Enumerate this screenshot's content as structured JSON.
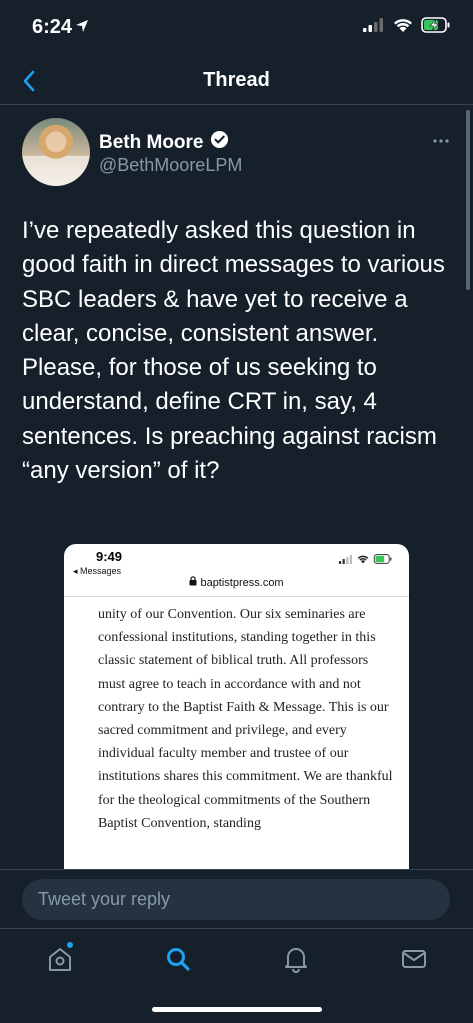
{
  "status_bar": {
    "time": "6:24"
  },
  "nav": {
    "title": "Thread"
  },
  "tweet": {
    "author_name": "Beth Moore",
    "author_handle": "@BethMooreLPM",
    "text": "I’ve repeatedly asked this question in good faith in direct messages to various SBC leaders & have yet to receive a clear, concise, consistent answer. Please, for those of us seeking to understand, define CRT in, say, 4 sentences. Is preaching against racism “any version” of it?"
  },
  "embedded_screenshot": {
    "time": "9:49",
    "back_label": "◂ Messages",
    "url": "baptistpress.com",
    "body": "unity of our Convention. Our six seminaries are confessional institutions, standing together in this classic statement of biblical truth. All professors must agree to teach in accordance with and not contrary to the Baptist Faith & Message. This is our sacred commitment and privilege, and every individual faculty member and trustee of our institutions shares this commitment. We are thankful for the theological commitments of the Southern Baptist Convention, standing"
  },
  "reply": {
    "placeholder": "Tweet your reply"
  },
  "tabs": [
    {
      "name": "home",
      "icon": "home-icon",
      "has_badge": true
    },
    {
      "name": "search",
      "icon": "search-icon",
      "active": true
    },
    {
      "name": "notifications",
      "icon": "bell-icon"
    },
    {
      "name": "messages",
      "icon": "mail-icon"
    }
  ],
  "colors": {
    "background": "#15202b",
    "accent": "#1da1f2",
    "muted": "#8899a6"
  }
}
